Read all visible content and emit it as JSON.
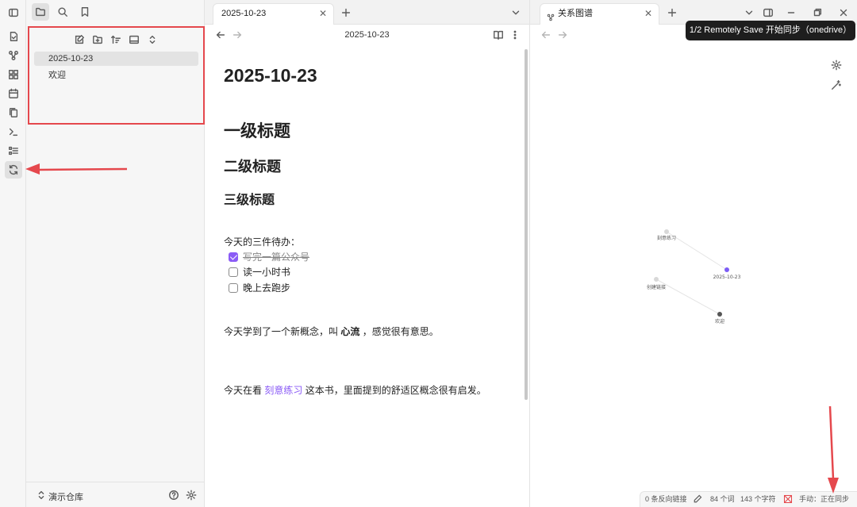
{
  "explorer": {
    "files": [
      "2025-10-23",
      "欢迎"
    ],
    "vault_name": "演示仓库"
  },
  "editor": {
    "tab_title": "2025-10-23",
    "view_title": "2025-10-23",
    "doc_title": "2025-10-23",
    "h1": "一级标题",
    "h2": "二级标题",
    "h3": "三级标题",
    "todo_intro": "今天的三件待办：",
    "tasks": [
      {
        "text": "写完一篇公众号",
        "done": true
      },
      {
        "text": "读一小时书",
        "done": false
      },
      {
        "text": "晚上去跑步",
        "done": false
      }
    ],
    "para1_before": "今天学到了一个新概念，叫",
    "para1_bold": "心流",
    "para1_after": "，感觉很有意思。",
    "para2_before": "今天在看",
    "para2_link": "刻意练习",
    "para2_after": "这本书，里面提到的舒适区概念很有启发。"
  },
  "graph": {
    "tab_title": "关系图谱",
    "nodes": [
      {
        "label": "刻意练习",
        "color": "#d8d8d8"
      },
      {
        "label": "2025-10-23",
        "color": "#7c5cf6"
      },
      {
        "label": "创建链接",
        "color": "#d8d8d8"
      },
      {
        "label": "欢迎",
        "color": "#555555"
      }
    ]
  },
  "notice": "1/2 Remotely Save 开始同步（onedrive）",
  "status": {
    "backlinks": "0 条反向链接",
    "words": "84 个词",
    "chars": "143 个字符",
    "sync": "手动：正在同步"
  },
  "colors": {
    "accent": "#8b5cf6",
    "annotation": "#e5484d"
  }
}
